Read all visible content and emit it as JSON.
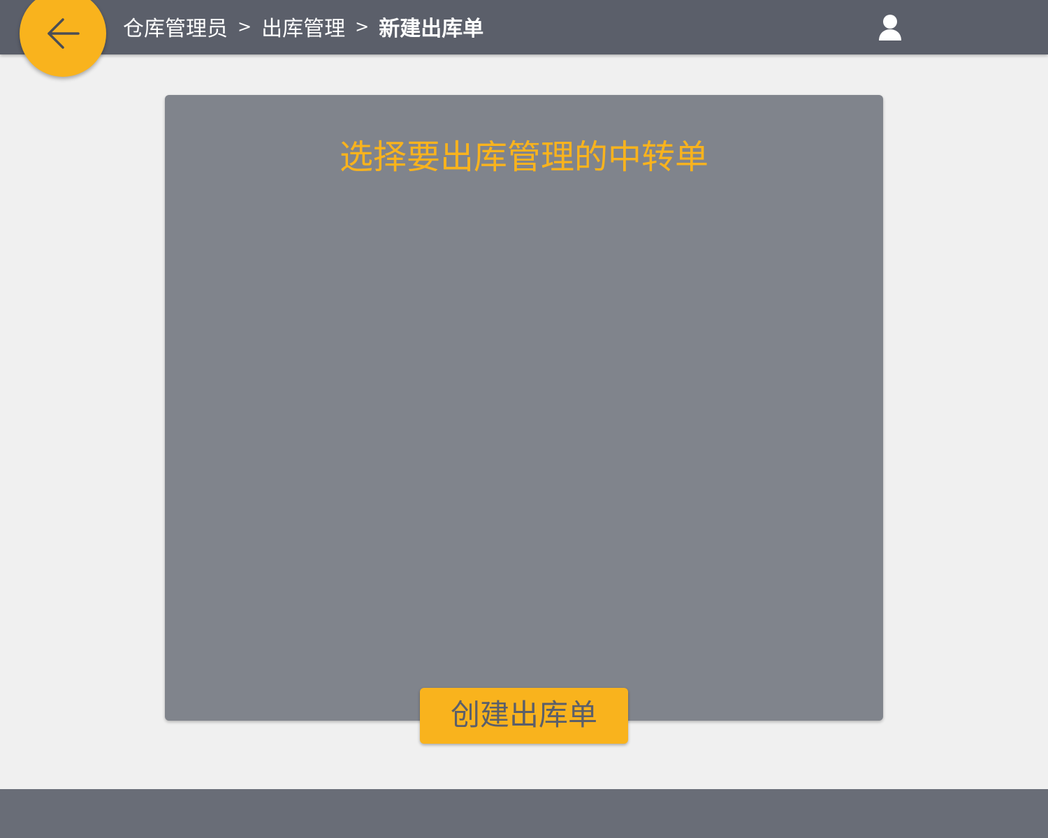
{
  "header": {
    "back_icon": "arrow-left-icon",
    "breadcrumb": [
      {
        "label": "仓库管理员"
      },
      {
        "label": "出库管理"
      },
      {
        "label": "新建出库单"
      }
    ],
    "separator": ">",
    "user_icon": "user-icon"
  },
  "main": {
    "title": "选择要出库管理的中转单",
    "create_button_label": "创建出库单",
    "items": []
  },
  "colors": {
    "accent": "#f9b31d",
    "header_bg": "#5b5f6a",
    "panel_bg": "#80848c",
    "page_bg": "#f0f0f0",
    "footer_bg": "#696d77"
  }
}
